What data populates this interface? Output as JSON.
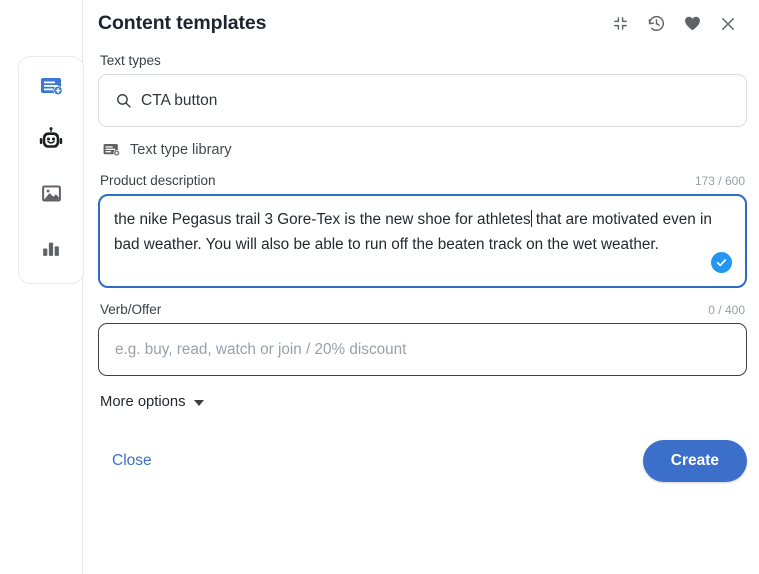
{
  "sidebar": {
    "items": [
      {
        "name": "text-generate",
        "icon": "text-add-icon",
        "active": true
      },
      {
        "name": "ai-assistant",
        "icon": "robot-icon",
        "active": false
      },
      {
        "name": "images",
        "icon": "image-icon",
        "active": false
      },
      {
        "name": "analytics",
        "icon": "bar-chart-icon",
        "active": false
      }
    ]
  },
  "header": {
    "title": "Content templates",
    "actions": [
      {
        "name": "collapse",
        "icon": "collapse-icon"
      },
      {
        "name": "history",
        "icon": "history-icon"
      },
      {
        "name": "favorite",
        "icon": "heart-icon"
      },
      {
        "name": "close",
        "icon": "close-icon"
      }
    ]
  },
  "text_types": {
    "label": "Text types",
    "value": "CTA button",
    "search_icon": "search-icon",
    "library_link": "Text type library",
    "library_icon": "text-type-library-icon"
  },
  "product_description": {
    "label": "Product description",
    "counter": "173 / 600",
    "value_part1": "the nike Pegasus trail 3 Gore-Tex is the new shoe for athletes",
    "value_part2": " that are motivated even in bad weather. You will also be able to run off the beaten track on the wet weather.",
    "valid_icon": "check-circle-icon"
  },
  "verb_offer": {
    "label": "Verb/Offer",
    "counter": "0 / 400",
    "value": "",
    "placeholder": "e.g. buy, read, watch or join / 20% discount"
  },
  "more_options": {
    "label": "More options",
    "icon": "chevron-down-icon"
  },
  "footer": {
    "close_label": "Close",
    "create_label": "Create"
  },
  "colors": {
    "accent": "#3b6fc9",
    "focus_border": "#2f6cc4",
    "check_badge": "#2196f3",
    "muted_text": "#9aa0a6"
  }
}
